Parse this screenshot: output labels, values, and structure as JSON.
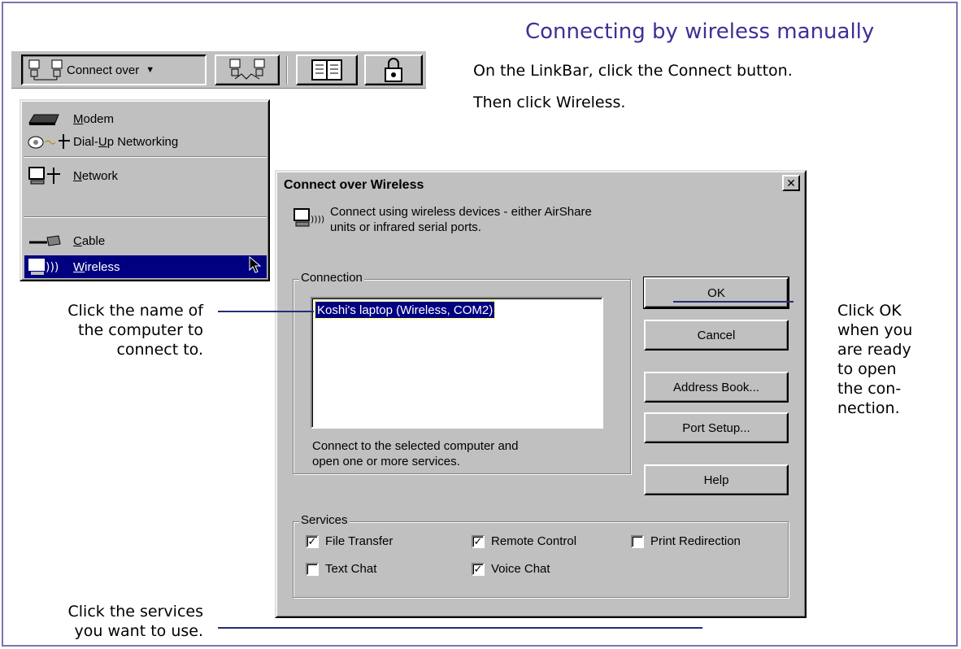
{
  "page": {
    "title": "Connecting by wireless manually",
    "instruction_1": "On the LinkBar, click the Connect button.",
    "instruction_2": "Then click Wireless.",
    "note_computer": [
      "Click the name of",
      "the computer to",
      "connect to."
    ],
    "note_services": [
      "Click the services",
      "you want to use."
    ],
    "note_ok": [
      "Click OK",
      "when you",
      "are ready",
      "to open",
      "the con-",
      "nection."
    ],
    "accent_color": "#3d3096"
  },
  "toolbar": {
    "connect_label": "Connect over",
    "buttons": [
      "connect-over-button",
      "transfer-icon-button",
      "book-icon-button",
      "lock-icon-button"
    ]
  },
  "menu": {
    "items": [
      {
        "label": "Modem",
        "accel": "M",
        "icon": "modem-icon"
      },
      {
        "label": "Dial-Up Networking",
        "accel": "U",
        "icon": "dialup-icon"
      },
      {
        "label": "Network",
        "accel": "N",
        "icon": "network-icon"
      },
      {
        "label": "Cable",
        "accel": "C",
        "icon": "cable-icon"
      },
      {
        "label": "Wireless",
        "accel": "W",
        "icon": "wireless-icon",
        "selected": true
      }
    ]
  },
  "dialog": {
    "title": "Connect over Wireless",
    "description_1": "Connect using wireless devices - either AirShare",
    "description_2": "units or infrared serial ports.",
    "connection_label": "Connection",
    "connection_items": [
      "Koshi's laptop (Wireless, COM2)"
    ],
    "hint_1": "Connect to the selected computer and",
    "hint_2": "open one or more services.",
    "buttons": {
      "ok": "OK",
      "cancel": "Cancel",
      "address_book": "Address Book...",
      "port_setup": "Port Setup...",
      "help": "Help"
    },
    "services_label": "Services",
    "services": [
      {
        "label": "File Transfer",
        "checked": true
      },
      {
        "label": "Remote Control",
        "checked": true
      },
      {
        "label": "Print Redirection",
        "checked": false
      },
      {
        "label": "Text Chat",
        "checked": false
      },
      {
        "label": "Voice Chat",
        "checked": true
      }
    ]
  }
}
